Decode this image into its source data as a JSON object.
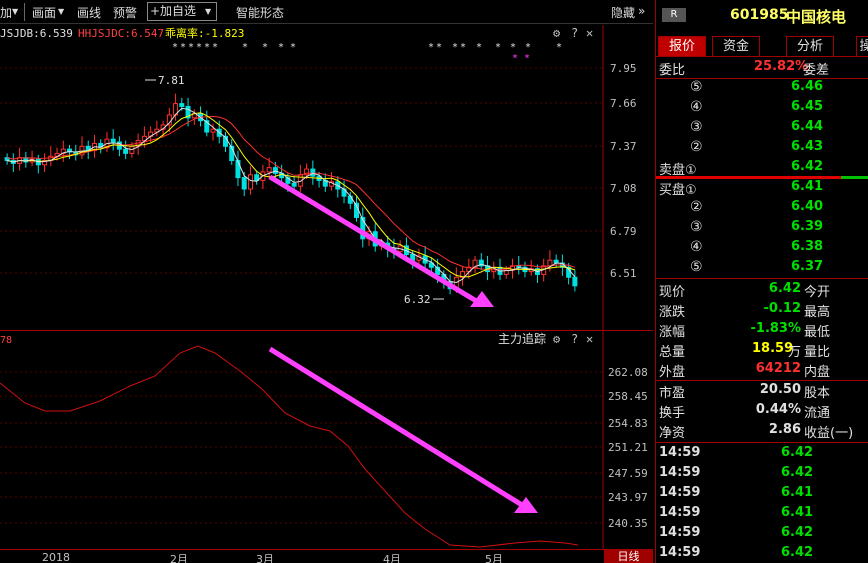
{
  "toolbar": {
    "items": [
      "加",
      "画面",
      "画线",
      "预警",
      "+加自选",
      "智能形态"
    ],
    "dropdown_arrow": "▼",
    "hide_label": "隐藏",
    "chevron": "»"
  },
  "main_chart": {
    "indicators": [
      {
        "label": "JSJDB:6.539",
        "color": "#e0e0e0"
      },
      {
        "label": "HHJSJDC:6.547",
        "color": "#ff4040"
      },
      {
        "label": "乖离率:-1.823",
        "color": "#ffff00"
      }
    ],
    "y_ticks": [
      "7.95",
      "7.66",
      "7.37",
      "7.08",
      "6.79",
      "6.51"
    ],
    "high_marker": "7.81",
    "low_marker": "6.32",
    "icons": [
      "gear-icon",
      "help-icon",
      "close-icon"
    ]
  },
  "sub_chart": {
    "title": "主力追踪",
    "left_label": "78",
    "y_ticks": [
      "262.08",
      "258.45",
      "254.83",
      "251.21",
      "247.59",
      "243.97",
      "240.35"
    ]
  },
  "x_axis": {
    "labels": [
      "2018",
      "2月",
      "3月",
      "4月",
      "5月"
    ],
    "period": "日线"
  },
  "panel": {
    "badge": "R",
    "code": "601985",
    "name": "中国核电",
    "tabs": [
      "报价",
      "资金",
      "分析",
      "操"
    ],
    "weibi_label": "委比",
    "weibi_value": "25.82%",
    "weicha_label": "委差",
    "sell": [
      {
        "label": "⑤",
        "price": "6.46"
      },
      {
        "label": "④",
        "price": "6.45"
      },
      {
        "label": "③",
        "price": "6.44"
      },
      {
        "label": "②",
        "price": "6.43"
      },
      {
        "label": "卖盘①",
        "price": "6.42"
      }
    ],
    "buy": [
      {
        "label": "买盘①",
        "price": "6.41"
      },
      {
        "label": "②",
        "price": "6.40"
      },
      {
        "label": "③",
        "price": "6.39"
      },
      {
        "label": "④",
        "price": "6.38"
      },
      {
        "label": "⑤",
        "price": "6.37"
      }
    ],
    "stats_left": [
      {
        "label": "现价",
        "value": "6.42",
        "color": "green"
      },
      {
        "label": "涨跌",
        "value": "-0.12",
        "color": "green"
      },
      {
        "label": "涨幅",
        "value": "-1.83%",
        "color": "green"
      },
      {
        "label": "总量",
        "value": "18.59",
        "suffix": "万",
        "color": "yellow"
      },
      {
        "label": "外盘",
        "value": "64212",
        "color": "red"
      }
    ],
    "stats_right": [
      "今开",
      "最高",
      "最低",
      "量比",
      "内盘"
    ],
    "stats2": [
      {
        "label": "市盈",
        "value": "20.50",
        "right": "股本"
      },
      {
        "label": "换手",
        "value": "0.44%",
        "right": "流通"
      },
      {
        "label": "净资",
        "value": "2.86",
        "right": "收益(一)"
      }
    ],
    "ticks": [
      {
        "time": "14:59",
        "price": "6.42"
      },
      {
        "time": "14:59",
        "price": "6.42"
      },
      {
        "time": "14:59",
        "price": "6.41"
      },
      {
        "time": "14:59",
        "price": "6.41"
      },
      {
        "time": "14:59",
        "price": "6.42"
      },
      {
        "time": "14:59",
        "price": "6.42"
      }
    ]
  }
}
